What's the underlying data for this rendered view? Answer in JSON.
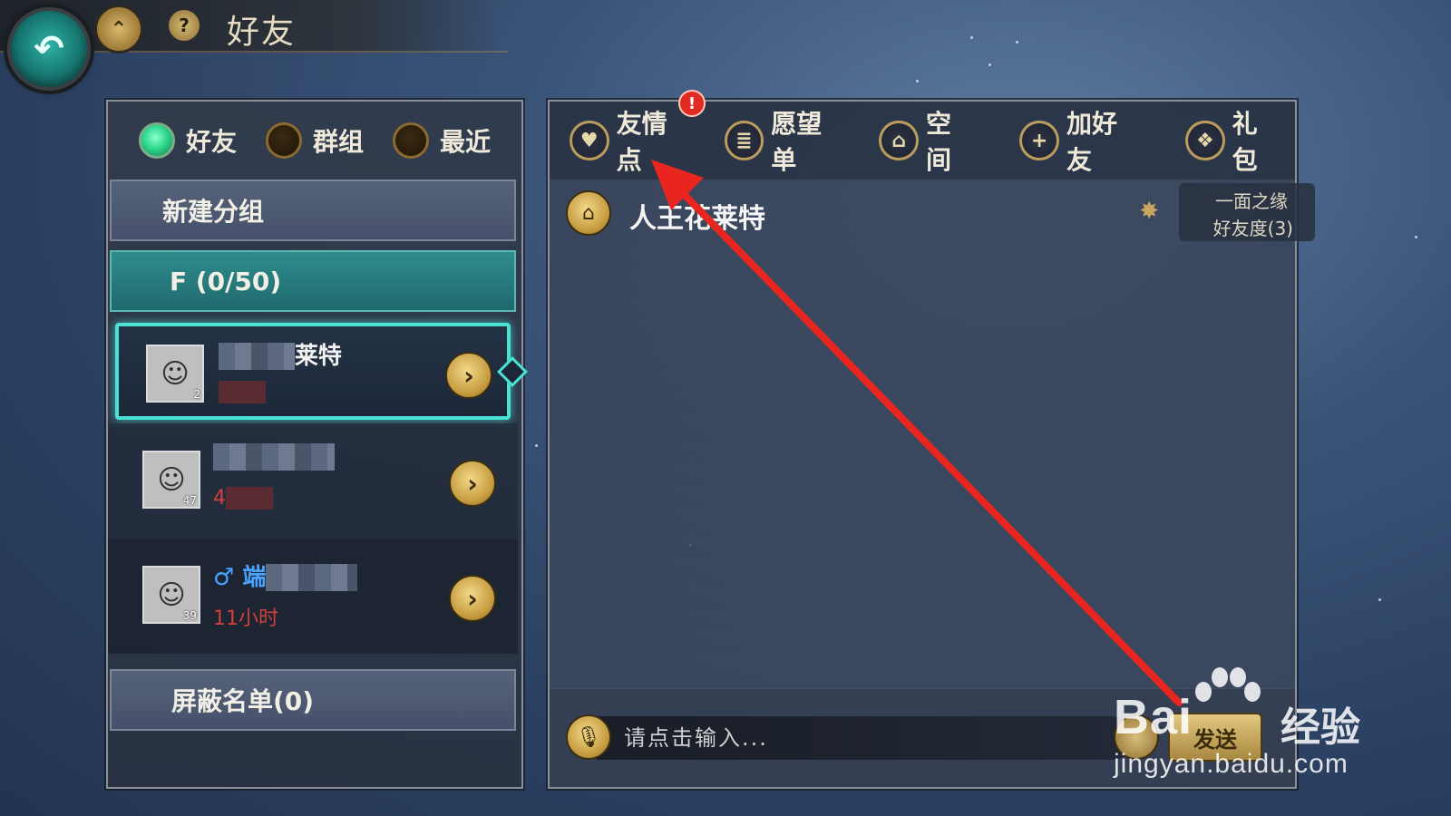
{
  "header": {
    "title": "好友"
  },
  "left_tabs": [
    {
      "label": "好友",
      "active": true
    },
    {
      "label": "群组",
      "active": false
    },
    {
      "label": "最近",
      "active": false
    }
  ],
  "groups": {
    "new_group": "新建分组",
    "friends_group": "F          (0/50)",
    "blocked": "屏蔽名单(0)"
  },
  "friends": [
    {
      "name_visible": "莱特",
      "level": "2",
      "status": ""
    },
    {
      "name_visible": "",
      "level": "47",
      "status": "4"
    },
    {
      "name_visible": "♂ 端",
      "level": "39",
      "status": "11小时"
    }
  ],
  "right_tabs": [
    {
      "label": "友情点",
      "icon": "heart-icon",
      "alert": "!"
    },
    {
      "label": "愿望单",
      "icon": "scroll-icon"
    },
    {
      "label": "空间",
      "icon": "home-icon"
    },
    {
      "label": "加好友",
      "icon": "plus-icon"
    },
    {
      "label": "礼包",
      "icon": "gift-icon"
    }
  ],
  "chat": {
    "partner_name": "人王花莱特",
    "relation_title": "一面之缘",
    "relation_value": "好友度(3)",
    "input_placeholder": "请点击输入...",
    "send_label": "发送"
  },
  "watermark": {
    "logo": "Bai",
    "suffix": "经验",
    "url": "jingyan.baidu.com"
  },
  "colors": {
    "accent_teal": "#49e2d4",
    "gold": "#c59a3e",
    "alert_red": "#e02b23",
    "status_red": "#d0413a"
  }
}
